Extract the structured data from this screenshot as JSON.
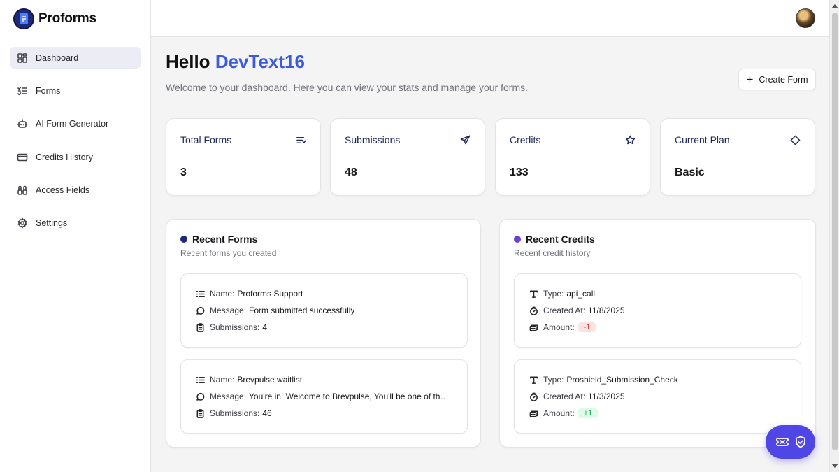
{
  "app": {
    "name": "Proforms"
  },
  "sidebar": {
    "items": [
      {
        "label": "Dashboard",
        "icon": "dashboard-icon",
        "active": true
      },
      {
        "label": "Forms",
        "icon": "list-icon"
      },
      {
        "label": "AI Form Generator",
        "icon": "bot-icon"
      },
      {
        "label": "Credits History",
        "icon": "credit-card-icon"
      },
      {
        "label": "Access Fields",
        "icon": "binoculars-icon"
      },
      {
        "label": "Settings",
        "icon": "gear-icon"
      }
    ]
  },
  "header": {
    "greeting": "Hello",
    "username": "DevText16",
    "subtitle": "Welcome to your dashboard. Here you can view your stats and manage your forms.",
    "create_label": "Create Form"
  },
  "stats": [
    {
      "title": "Total Forms",
      "value": "3",
      "icon": "list-filter-icon"
    },
    {
      "title": "Submissions",
      "value": "48",
      "icon": "send-icon"
    },
    {
      "title": "Credits",
      "value": "133",
      "icon": "star-icon"
    },
    {
      "title": "Current Plan",
      "value": "Basic",
      "icon": "diamond-icon"
    }
  ],
  "recent_forms": {
    "title": "Recent Forms",
    "subtitle": "Recent forms you created",
    "dot_color": "#1e2a78",
    "items": [
      {
        "name_label": "Name:",
        "name": "Proforms Support",
        "message_label": "Message:",
        "message": "Form submitted successfully",
        "submissions_label": "Submissions:",
        "submissions": "4"
      },
      {
        "name_label": "Name:",
        "name": "Brevpulse waitlist",
        "message_label": "Message:",
        "message": "You're in! Welcome to Brevpulse, You'll be one of the first to know when we launch.",
        "submissions_label": "Submissions:",
        "submissions": "46"
      }
    ]
  },
  "recent_credits": {
    "title": "Recent Credits",
    "subtitle": "Recent credit history",
    "dot_color": "#6d3fd1",
    "items": [
      {
        "type_label": "Type:",
        "type": "api_call",
        "created_label": "Created At:",
        "created": "11/8/2025",
        "amount_label": "Amount:",
        "amount": "-1"
      },
      {
        "type_label": "Type:",
        "type": "Proshield_Submission_Check",
        "created_label": "Created At:",
        "created": "11/3/2025",
        "amount_label": "Amount:",
        "amount": "+1"
      }
    ]
  },
  "colors": {
    "accent": "#3b5bdb",
    "fab": "#4f46e5"
  }
}
